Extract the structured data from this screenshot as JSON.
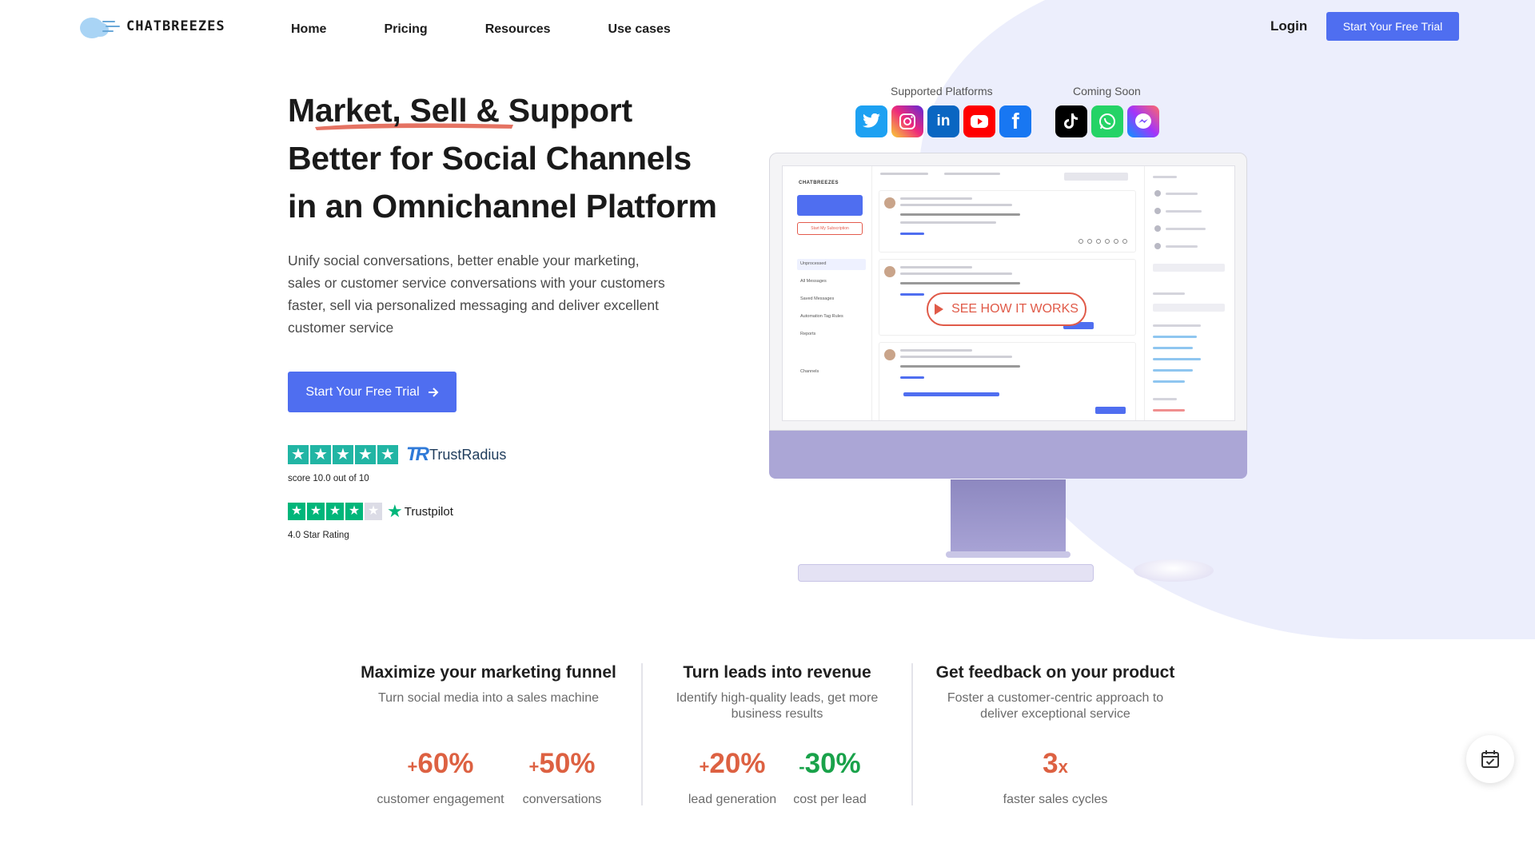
{
  "brand": {
    "name": "CHATBREEZES"
  },
  "nav": {
    "links": [
      "Home",
      "Pricing",
      "Resources",
      "Use cases"
    ],
    "login": "Login",
    "cta": "Start Your Free Trial"
  },
  "hero": {
    "title_line1": "Market, Sell & Support",
    "title_line2": "Better for Social Channels",
    "title_line3": "in an Omnichannel Platform",
    "description": "Unify social conversations, better enable your marketing, sales or customer service conversations with your customers faster, sell via personalized messaging and deliver excellent customer service",
    "cta": "Start Your Free Trial",
    "accent_color": "#e05a48"
  },
  "ratings": {
    "trustradius": {
      "brand": "TrustRadius",
      "mark": "TR",
      "score_text": "score 10.0 out of 10",
      "stars": 5,
      "color": "#21b5a4"
    },
    "trustpilot": {
      "brand": "Trustpilot",
      "score_text": "4.0 Star Rating",
      "stars": 4,
      "max_stars": 5,
      "color": "#00b67a"
    }
  },
  "platforms": {
    "supported_label": "Supported Platforms",
    "coming_label": "Coming Soon",
    "supported": [
      {
        "name": "twitter-icon",
        "glyph": "🐦",
        "color": "#1da1f2"
      },
      {
        "name": "instagram-icon",
        "glyph": "◎",
        "color": "#d6249f"
      },
      {
        "name": "linkedin-icon",
        "glyph": "in",
        "color": "#0a66c2"
      },
      {
        "name": "youtube-icon",
        "glyph": "▶",
        "color": "#ff0000"
      },
      {
        "name": "facebook-icon",
        "glyph": "f",
        "color": "#1877f2"
      }
    ],
    "coming": [
      {
        "name": "tiktok-icon",
        "glyph": "♪",
        "color": "#000000"
      },
      {
        "name": "whatsapp-icon",
        "glyph": "✆",
        "color": "#25d366"
      },
      {
        "name": "messenger-icon",
        "glyph": "ϟ",
        "color": "#a334fa"
      }
    ]
  },
  "demo": {
    "cta": "SEE HOW IT WORKS",
    "app_logo": "CHATBREEZES",
    "subscription": "Start My Subscription",
    "menu": [
      "Unprocessed",
      "All Messages",
      "Saved Messages",
      "Automation Tag Rules",
      "Reports"
    ],
    "settings": "Channels"
  },
  "features": [
    {
      "title": "Maximize your marketing funnel",
      "subtitle": "Turn social media into a sales machine",
      "stats": [
        {
          "sign": "+",
          "value": "60%",
          "label": "customer engagement",
          "tone": "red"
        },
        {
          "sign": "+",
          "value": "50%",
          "label": "conversations",
          "tone": "red"
        }
      ]
    },
    {
      "title": "Turn leads into revenue",
      "subtitle": "Identify high-quality leads, get more business results",
      "stats": [
        {
          "sign": "+",
          "value": "20%",
          "label": "lead generation",
          "tone": "red"
        },
        {
          "sign": "-",
          "value": "30%",
          "label": "cost per lead",
          "tone": "green"
        }
      ]
    },
    {
      "title": "Get feedback on your product",
      "subtitle": "Foster a customer-centric approach to deliver exceptional service",
      "stats": [
        {
          "sign": "",
          "value": "3",
          "suffix": "x",
          "label": "faster sales cycles",
          "tone": "red"
        }
      ]
    }
  ],
  "colors": {
    "primary": "#4f6ef0",
    "stat_red": "#dd6142",
    "stat_green": "#19a24a",
    "blob": "#eceefc"
  }
}
